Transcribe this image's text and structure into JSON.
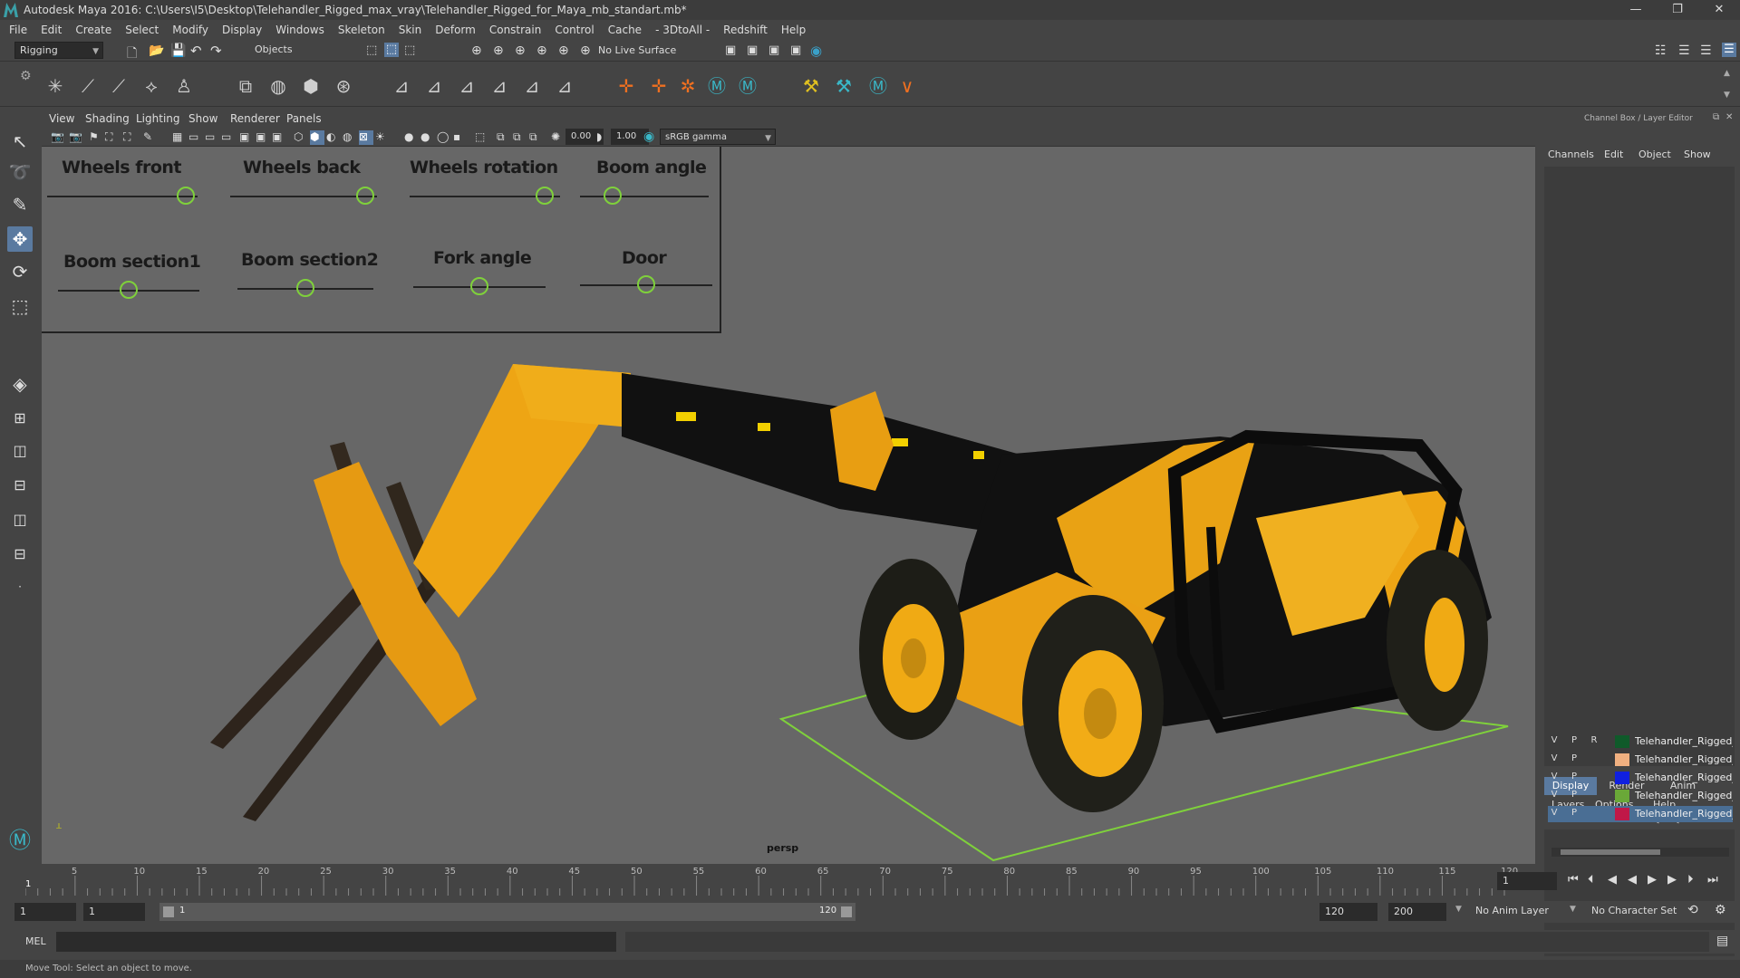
{
  "window": {
    "title": "Autodesk Maya 2016: C:\\Users\\I5\\Desktop\\Telehandler_Rigged_max_vray\\Telehandler_Rigged_for_Maya_mb_standart.mb*",
    "minimize": "—",
    "restore": "❐",
    "close": "✕"
  },
  "menubar": [
    "File",
    "Edit",
    "Create",
    "Select",
    "Modify",
    "Display",
    "Windows",
    "Skeleton",
    "Skin",
    "Deform",
    "Constrain",
    "Control",
    "Cache",
    "- 3DtoAll -",
    "Redshift",
    "Help"
  ],
  "statusline": {
    "menuset": "Rigging",
    "select_mode": "Objects",
    "live_surface": "No Live Surface"
  },
  "viewport": {
    "panel_menus": [
      "View",
      "Shading",
      "Lighting",
      "Show",
      "Renderer",
      "Panels"
    ],
    "exposure": "0.00",
    "gamma": "1.00",
    "color_space": "sRGB gamma",
    "camera_label": "persp",
    "controls": [
      {
        "label": "Wheels front",
        "value": 0.92
      },
      {
        "label": "Wheels back",
        "value": 0.92
      },
      {
        "label": "Wheels rotation",
        "value": 0.9
      },
      {
        "label": "Boom angle",
        "value": 0.25
      },
      {
        "label": "Boom section1",
        "value": 0.5
      },
      {
        "label": "Boom section2",
        "value": 0.5
      },
      {
        "label": "Fork angle",
        "value": 0.5
      },
      {
        "label": "Door",
        "value": 0.5
      }
    ]
  },
  "channel_box": {
    "title": "Channel Box / Layer Editor",
    "menus": [
      "Channels",
      "Edit",
      "Object",
      "Show"
    ],
    "tabs": [
      "Display",
      "Render",
      "Anim"
    ],
    "layer_menus": [
      "Layers",
      "Options",
      "Help"
    ],
    "layers": [
      {
        "v": "V",
        "p": "P",
        "r": "R",
        "color": "#0f5a2a",
        "name": "Telehandler_Rigged_c"
      },
      {
        "v": "V",
        "p": "P",
        "r": "",
        "color": "#f0b080",
        "name": "Telehandler_Rigged_h"
      },
      {
        "v": "V",
        "p": "P",
        "r": "",
        "color": "#1020e0",
        "name": "Telehandler_Rigged_b"
      },
      {
        "v": "V",
        "p": "P",
        "r": "",
        "color": "#6aa838",
        "name": "Telehandler_Rigged_c"
      },
      {
        "v": "V",
        "p": "P",
        "r": "",
        "color": "#c01848",
        "name": "Telehandler_Rigged_F"
      }
    ]
  },
  "timeline": {
    "ticks": [
      "5",
      "10",
      "15",
      "20",
      "25",
      "30",
      "35",
      "40",
      "45",
      "50",
      "55",
      "60",
      "65",
      "70",
      "75",
      "80",
      "85",
      "90",
      "95",
      "100",
      "105",
      "110",
      "115",
      "120"
    ],
    "current_frame_label": "1",
    "current_frame": "1"
  },
  "range": {
    "start": "1",
    "playback_start": "1",
    "slider_start": "1",
    "slider_end": "120",
    "playback_end": "120",
    "end": "200",
    "anim_layer": "No Anim Layer",
    "character_set": "No Character Set"
  },
  "command": {
    "lang": "MEL"
  },
  "helpline": "Move Tool: Select an object to move."
}
